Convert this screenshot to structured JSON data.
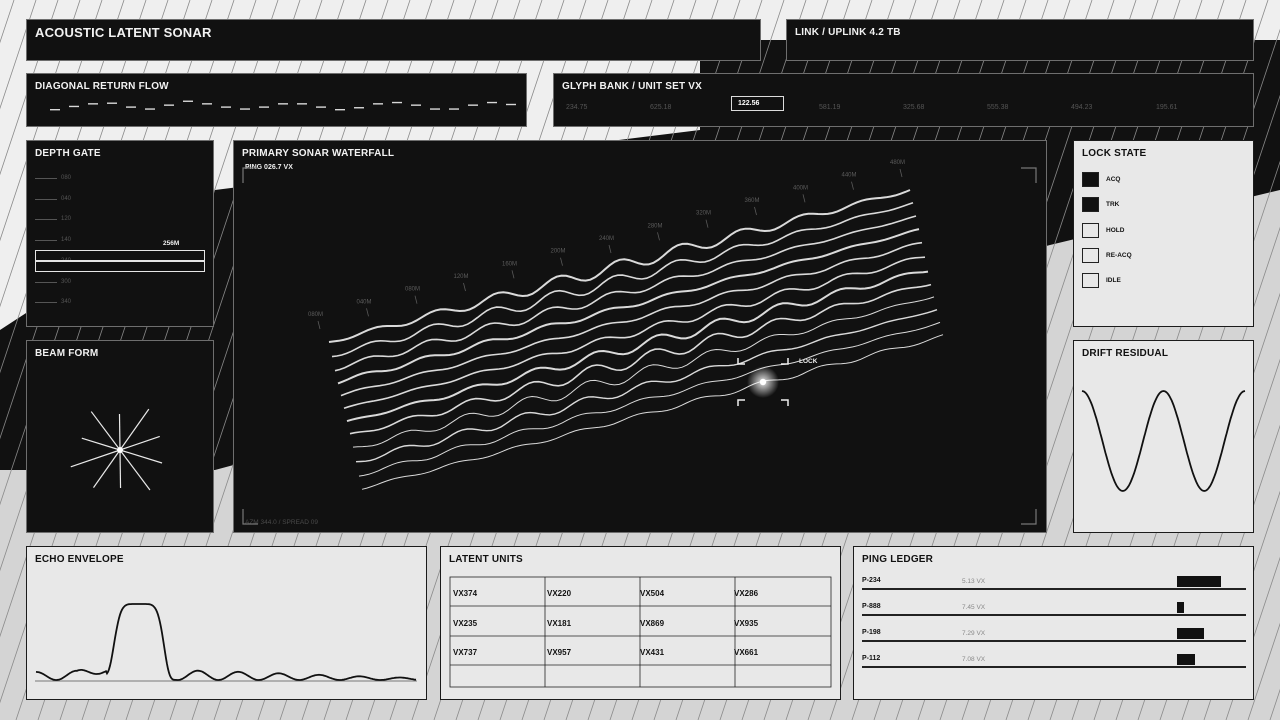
{
  "header": {
    "title": "ACOUSTIC LATENT SONAR",
    "link": "LINK / UPLINK 4.2 TB"
  },
  "diagonal_flow": {
    "title": "DIAGONAL RETURN FLOW",
    "levels": [
      0.1,
      0.35,
      0.55,
      0.6,
      0.3,
      0.15,
      0.45,
      0.75,
      0.55,
      0.3,
      0.15,
      0.3,
      0.55,
      0.55,
      0.3,
      0.1,
      0.25,
      0.55,
      0.65,
      0.45,
      0.15,
      0.15,
      0.45,
      0.65,
      0.5
    ]
  },
  "glyph_bank": {
    "title": "GLYPH BANK / UNIT SET VX",
    "values": [
      "234.75",
      "625.18",
      "122.56",
      "581.19",
      "325.68",
      "555.38",
      "494.23",
      "195.61"
    ],
    "selected_index": 2
  },
  "depth_gate": {
    "title": "DEPTH GATE",
    "scale": [
      "080",
      "040",
      "120",
      "140",
      "240",
      "300",
      "340"
    ],
    "marker": "256M"
  },
  "beam_form": {
    "title": "BEAM FORM",
    "spokes": 10
  },
  "waterfall": {
    "title": "PRIMARY SONAR WATERFALL",
    "ping": "PING 026.7 VX",
    "footer": "AZM 344.0 / SPREAD 09",
    "range_labels": [
      "080M",
      "040M",
      "080M",
      "120M",
      "160M",
      "200M",
      "240M",
      "280M",
      "320M",
      "360M",
      "400M",
      "440M",
      "480M"
    ],
    "lock_label": "LOCK",
    "line_count": 12
  },
  "lock_state": {
    "title": "LOCK STATE",
    "items": [
      {
        "label": "ACQ",
        "active": true
      },
      {
        "label": "TRK",
        "active": true
      },
      {
        "label": "HOLD",
        "active": false
      },
      {
        "label": "RE-ACQ",
        "active": false
      },
      {
        "label": "IDLE",
        "active": false
      }
    ]
  },
  "drift_residual": {
    "title": "DRIFT RESIDUAL"
  },
  "echo_envelope": {
    "title": "ECHO ENVELOPE"
  },
  "latent_units": {
    "title": "LATENT UNITS",
    "rows": [
      [
        "VX374",
        "VX220",
        "VX504",
        "VX286"
      ],
      [
        "VX235",
        "VX181",
        "VX869",
        "VX935"
      ],
      [
        "VX737",
        "VX957",
        "VX431",
        "VX661"
      ]
    ]
  },
  "ping_ledger": {
    "title": "PING LEDGER",
    "entries": [
      {
        "id": "P-234",
        "value": "5.13 VX",
        "level": 1.0
      },
      {
        "id": "P-888",
        "value": "7.45 VX",
        "level": 0.16
      },
      {
        "id": "P-198",
        "value": "7.29 VX",
        "level": 0.62
      },
      {
        "id": "P-112",
        "value": "7.08 VX",
        "level": 0.4
      }
    ]
  },
  "colors": {
    "panel_dark": "#111111",
    "panel_light": "#e8e8e8",
    "stroke_light": "#f2f2f2",
    "stroke_dark": "#111111"
  }
}
